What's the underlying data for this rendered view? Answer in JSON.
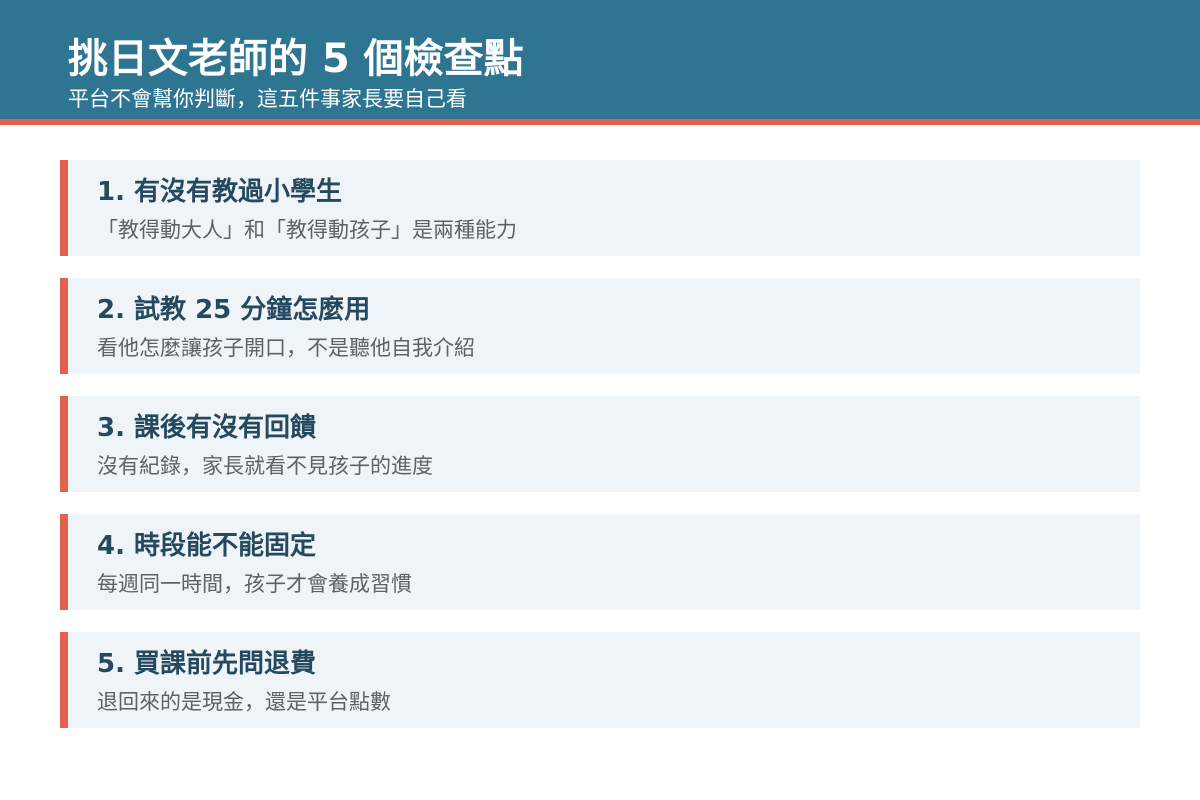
{
  "header": {
    "title": "挑日文老師的 5 個檢查點",
    "subtitle": "平台不會幫你判斷，這五件事家長要自己看"
  },
  "colors": {
    "header_bg": "#2e7592",
    "accent": "#e2624f",
    "card_bg": "#eef4f7",
    "card_title": "#25495e",
    "card_text": "#5d6268"
  },
  "checkpoints": [
    {
      "title": "1. 有沒有教過小學生",
      "description": "「教得動大人」和「教得動孩子」是兩種能力"
    },
    {
      "title": "2. 試教 25 分鐘怎麼用",
      "description": "看他怎麼讓孩子開口，不是聽他自我介紹"
    },
    {
      "title": "3. 課後有沒有回饋",
      "description": "沒有紀錄，家長就看不見孩子的進度"
    },
    {
      "title": "4. 時段能不能固定",
      "description": "每週同一時間，孩子才會養成習慣"
    },
    {
      "title": "5. 買課前先問退費",
      "description": "退回來的是現金，還是平台點數"
    }
  ]
}
